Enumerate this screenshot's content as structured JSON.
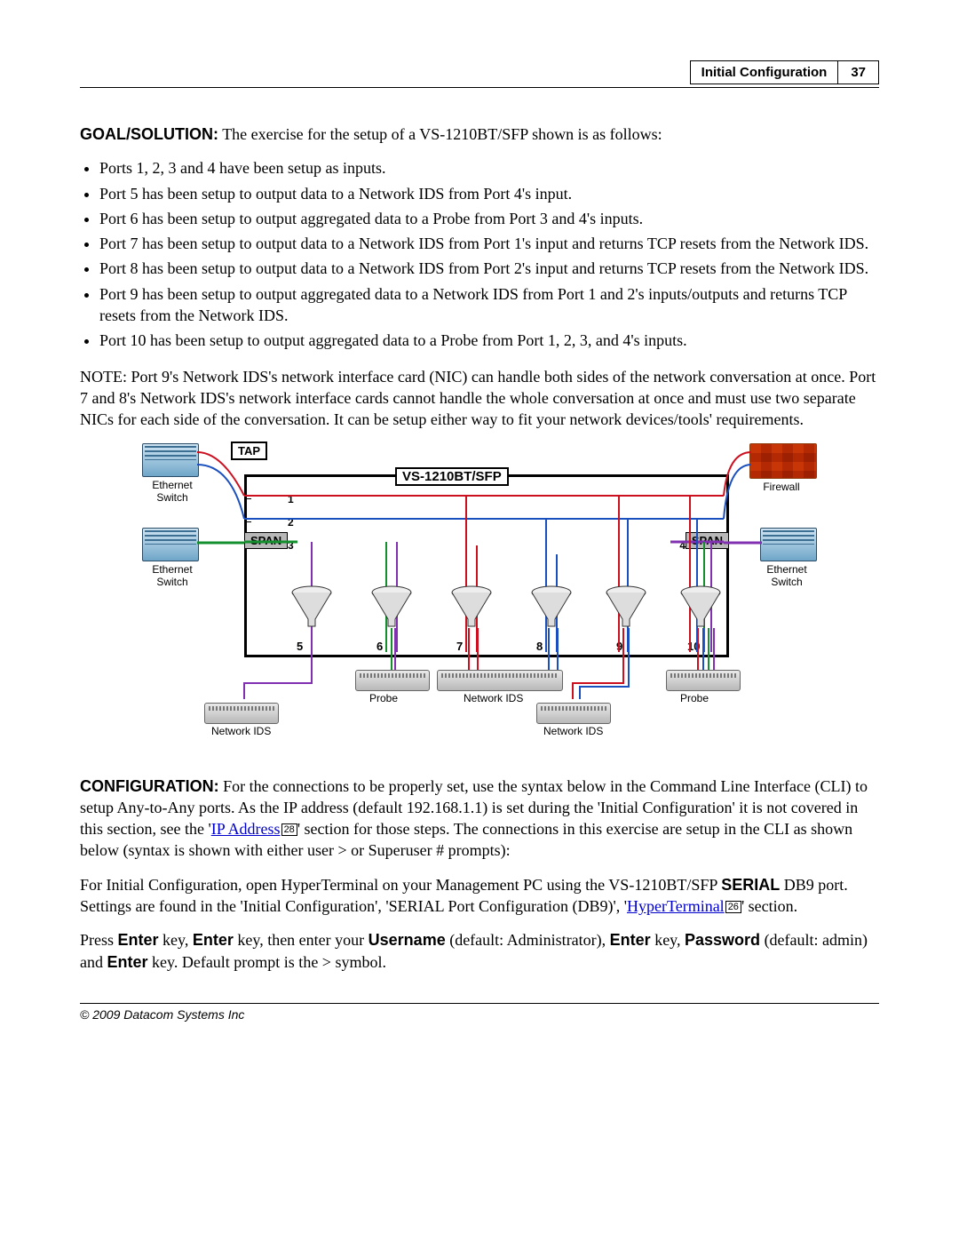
{
  "header": {
    "section_title": "Initial Configuration",
    "page_number": "37"
  },
  "goal": {
    "label": "GOAL/SOLUTION:",
    "text": "The exercise for the setup of a VS-1210BT/SFP shown is as follows:"
  },
  "bullets": [
    "Ports 1, 2, 3 and 4 have been setup as inputs.",
    "Port 5 has been setup to output data to a Network IDS from Port 4's input.",
    "Port 6 has been setup to output aggregated data to a Probe from Port 3 and 4's inputs.",
    "Port 7 has been setup to output data to a Network IDS from Port 1's input and returns TCP resets from the Network IDS.",
    "Port 8 has been setup to output data to a Network IDS from Port 2's input and returns TCP resets from the Network IDS.",
    "Port 9 has been setup to output aggregated data to a Network IDS from Port 1 and 2's inputs/outputs and returns TCP resets from the Network IDS.",
    "Port 10 has been setup to output aggregated data to a Probe from Port 1, 2, 3, and 4's inputs."
  ],
  "note": "NOTE: Port 9's Network IDS's network interface card (NIC) can handle both sides of the network conversation at once. Port 7 and 8's Network IDS's network interface cards cannot handle the whole conversation at once and must use two separate NICs for each side of the conversation. It can be setup either way to fit your network devices/tools' requirements.",
  "figure": {
    "tap": "TAP",
    "title": "VS-1210BT/SFP",
    "span": "SPAN",
    "ethernet_switch": "Ethernet Switch",
    "firewall": "Firewall",
    "ports_top": [
      "1",
      "2",
      "3",
      "4"
    ],
    "ports_bottom": [
      "5",
      "6",
      "7",
      "8",
      "9",
      "10"
    ],
    "probe": "Probe",
    "network_ids": "Network IDS"
  },
  "configuration": {
    "label": "CONFIGURATION:",
    "text_before_link": "For the connections to be properly set, use the syntax below in the Command Line Interface (CLI) to setup Any-to-Any ports. As the IP address (default 192.168.1.1) is set during the 'Initial Configuration' it is not covered in this section, see the '",
    "link1": "IP Address",
    "ref1": "28",
    "text_after_link": "' section for those steps. The connections in this exercise are setup in the CLI as shown below (syntax is shown with either user > or Superuser # prompts):"
  },
  "serial_para": {
    "intro": "For Initial Configuration, open HyperTerminal on your Management PC using the VS-1210BT/SFP ",
    "serial_label": "SERIAL",
    "rest1": " DB9 port. Settings are found in the 'Initial Configuration', 'SERIAL Port Configuration (DB9)', '",
    "link2": "HyperTerminal",
    "ref2": "26",
    "rest2": "' section."
  },
  "press_para": {
    "p1": "Press ",
    "enter": "Enter",
    "p2": " key, ",
    "p3": " key, then enter your ",
    "username": "Username",
    "p4": " (default: Administrator),  ",
    "p5": " key, ",
    "password": "Password",
    "p6": " (default: admin) and ",
    "p7": " key. Default prompt is the > symbol."
  },
  "footer": "© 2009 Datacom Systems Inc"
}
